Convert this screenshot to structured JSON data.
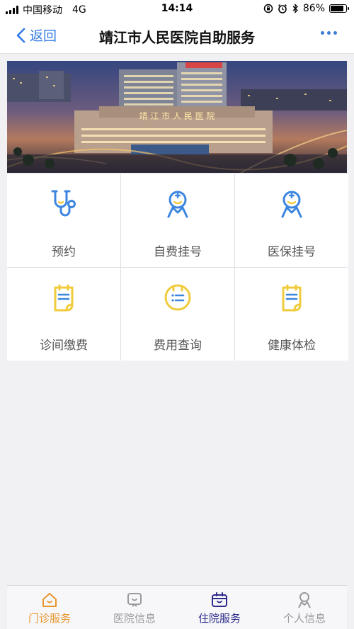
{
  "status_bar": {
    "carrier": "中国移动",
    "network": "4G",
    "time": "14:14",
    "battery": "86%",
    "battery_level": 0.86
  },
  "nav": {
    "back_label": "返回",
    "title": "靖江市人民医院自助服务"
  },
  "banner": {
    "sign_text": "靖 江 市 人 民 医 院"
  },
  "services": [
    {
      "label": "预约",
      "icon": "stethoscope-icon",
      "color": "#3d86e0"
    },
    {
      "label": "自费挂号",
      "icon": "doctor-icon",
      "color": "#3d86e0"
    },
    {
      "label": "医保挂号",
      "icon": "doctor-icon",
      "color": "#3d86e0"
    },
    {
      "label": "诊间缴费",
      "icon": "clipboard-icon",
      "color": "#f0cb3c"
    },
    {
      "label": "费用查询",
      "icon": "list-icon",
      "color": "#f0cb3c"
    },
    {
      "label": "健康体检",
      "icon": "clipboard-icon",
      "color": "#f0cb3c"
    }
  ],
  "tabs": [
    {
      "label": "门诊服务",
      "icon": "home-icon",
      "color": "#e8962e",
      "active": true
    },
    {
      "label": "医院信息",
      "icon": "hospital-info-icon",
      "color": "#9a9a9f",
      "active": false
    },
    {
      "label": "住院服务",
      "icon": "inpatient-icon",
      "color": "#2c2b8c",
      "active": false
    },
    {
      "label": "个人信息",
      "icon": "person-icon",
      "color": "#9a9a9f",
      "active": false
    }
  ]
}
